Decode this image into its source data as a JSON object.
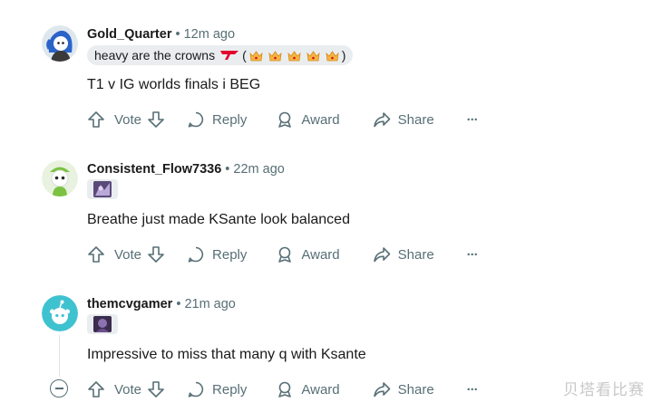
{
  "comments": [
    {
      "username": "Gold_Quarter",
      "separator": "•",
      "time": "12m ago",
      "flair_text": "heavy are the crowns",
      "flair_paren_open": "(",
      "flair_paren_close": ")",
      "body": "T1 v IG worlds finals i BEG",
      "actions": {
        "vote": "Vote",
        "reply": "Reply",
        "award": "Award",
        "share": "Share",
        "more": "···"
      }
    },
    {
      "username": "Consistent_Flow7336",
      "separator": "•",
      "time": "22m ago",
      "body": "Breathe just made KSante look balanced",
      "actions": {
        "vote": "Vote",
        "reply": "Reply",
        "award": "Award",
        "share": "Share",
        "more": "···"
      }
    },
    {
      "username": "themcvgamer",
      "separator": "•",
      "time": "21m ago",
      "body": "Impressive to miss that many q with Ksante",
      "actions": {
        "vote": "Vote",
        "reply": "Reply",
        "award": "Award",
        "share": "Share",
        "more": "···"
      }
    }
  ],
  "watermark": "贝塔看比赛",
  "colors": {
    "muted": "#576f76",
    "text": "#1a1a1b",
    "flair_bg": "#eaedef",
    "t1_red": "#e2012d",
    "crown_gold": "#f5b63d"
  }
}
